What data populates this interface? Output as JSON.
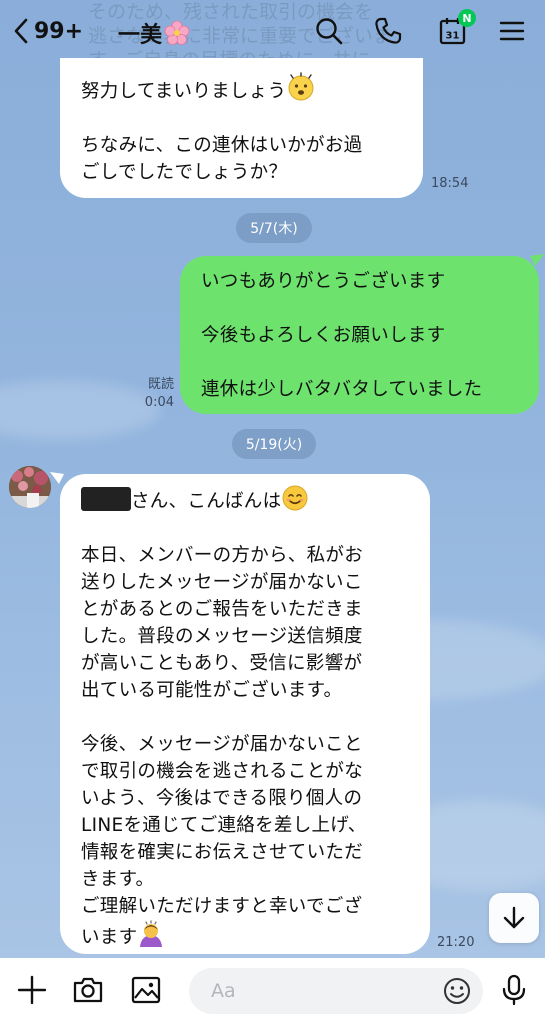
{
  "header": {
    "ghost_lines": [
      "そのため、残された取引の機会を",
      "逃さない為に非常に重要でございま",
      "す。ご自身の目標のために、共に"
    ],
    "unread_count": "99+",
    "room_name": "一美"
  },
  "messages": {
    "msg1": {
      "line1": "努力してまいりましょう",
      "line2": "ちなみに、この連休はいかがお過",
      "line3": "ごしでしたでしょうか？",
      "time": "18:54"
    },
    "date1": "5/7(木)",
    "msg2": {
      "line1": "いつもありがとうございます",
      "line2": "今後もよろしくお願いします",
      "line3": "連休は少しバタバタしていました",
      "read_label": "既読",
      "time": "0:04"
    },
    "date2": "5/19(火)",
    "msg3": {
      "greeting": "さん、こんばんは",
      "p1": [
        "本日、メンバーの方から、私がお",
        "送りしたメッセージが届かないこ",
        "とがあるとのご報告をいただきま",
        "した。普段のメッセージ送信頻度",
        "が高いこともあり、受信に影響が",
        "出ている可能性がございます。"
      ],
      "p2": [
        "今後、メッセージが届かないこと",
        "で取引の機会を逃されることがな",
        "いよう、今後はできる限り個人の",
        "LINEを通じてご連絡を差し上げ、",
        "情報を確実にお伝えさせていただ",
        "きます。",
        "ご理解いただけますと幸いでござ"
      ],
      "last": "います",
      "time": "21:20"
    }
  },
  "input": {
    "placeholder": "Aa"
  },
  "colors": {
    "bg": "#8fb2dd",
    "outgoing": "#6de36d",
    "incoming": "#ffffff",
    "badge": "#06c755"
  },
  "icons": [
    "chevron-left-icon",
    "search-icon",
    "phone-icon",
    "calendar-icon",
    "menu-icon",
    "plus-icon",
    "camera-icon",
    "image-icon",
    "smile-icon",
    "mic-icon",
    "arrow-down-icon"
  ]
}
